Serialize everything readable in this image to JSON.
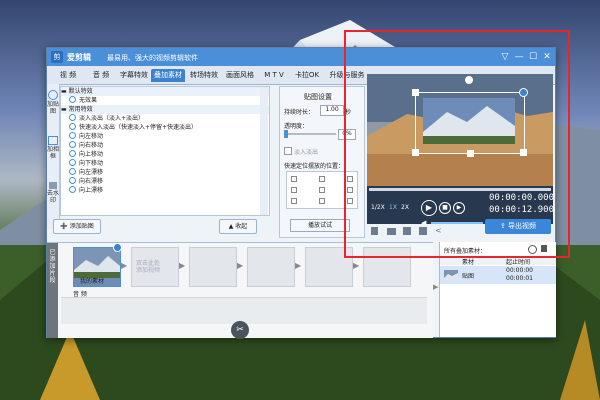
{
  "app": {
    "logo": "剪",
    "title": "爱剪辑",
    "subtitle": "最易用、强大的视频剪辑软件"
  },
  "window_controls": [
    "▽",
    "—",
    "☐",
    "✕"
  ],
  "tabs": [
    "视 频",
    "音 频",
    "字幕特效",
    "叠加素材",
    "转场特效",
    "画面风格",
    "M T V",
    "卡拉OK",
    "升级与服务"
  ],
  "active_tab_index": 3,
  "side_tabs": [
    "加贴图",
    "加相框",
    "去水印"
  ],
  "effects": {
    "default_header": "默认特效",
    "none_effect": "无效果",
    "common_header": "常用特效",
    "items": [
      "淡入淡出（淡入+淡出）",
      "快速淡入淡出（快速淡入+停留+快速淡出）",
      "向左移动",
      "向右移动",
      "向上移动",
      "向下移动",
      "向左漂移",
      "向右漂移",
      "向上漂移"
    ]
  },
  "add_sticker_button": "添加贴图",
  "collapse_button": "收起",
  "settings": {
    "title": "贴图设置",
    "duration_label": "持续时长：",
    "duration_value": "1.00",
    "duration_unit": "秒",
    "opacity_label": "透明度：",
    "opacity_value": "0%",
    "fade_label": "淡入淡出",
    "position_label": "快速定位摆放的位置：",
    "play_button": "播放试试"
  },
  "player": {
    "speeds": [
      "1/2X",
      "1X",
      "2X"
    ],
    "current_time": "00:00:00.000",
    "total_time": "00:00:12.900",
    "export_button": "导出视频",
    "volume_icon": "speaker-icon"
  },
  "timeline": {
    "side_label": "已添加片段",
    "clip_label": "我的素材",
    "placeholder_text": "双击此处\n添加视频",
    "audio_label": "音 频"
  },
  "right_panel": {
    "title": "所有叠加素材：",
    "col_material": "素材",
    "col_time": "起止时间",
    "row_name": "贴图",
    "row_start": "00:00:00",
    "row_end": "00:00:01"
  },
  "colors": {
    "accent": "#3c82d0",
    "highlight_box": "#e8242c",
    "title_bar": "#4a8fd8"
  }
}
